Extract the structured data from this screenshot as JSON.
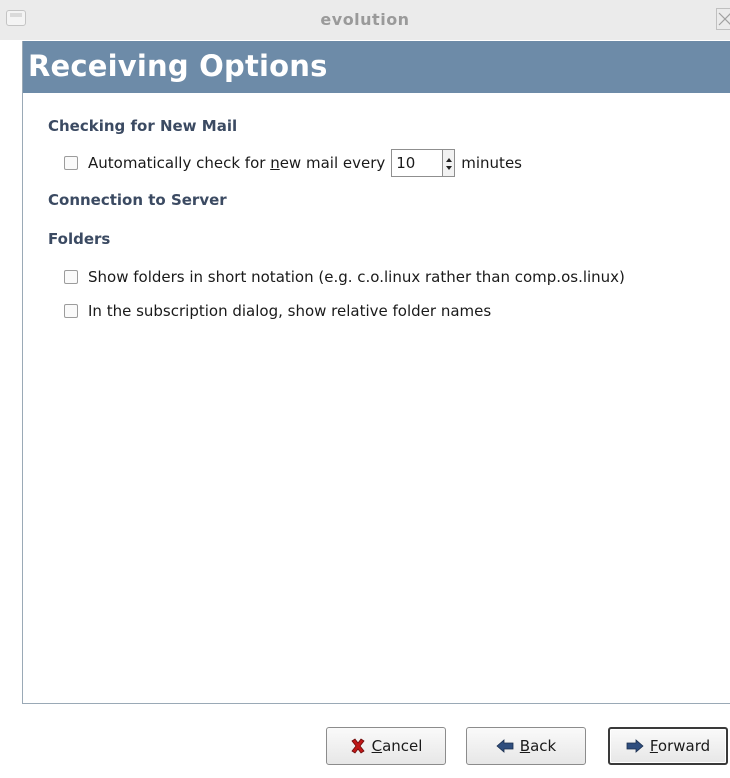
{
  "window": {
    "title": "evolution"
  },
  "header": {
    "title": "Receiving Options"
  },
  "sections": {
    "checking": {
      "title": "Checking for New Mail"
    },
    "connection": {
      "title": "Connection to Server"
    },
    "folders": {
      "title": "Folders"
    }
  },
  "auto_check": {
    "label_before": "Automatically check for ",
    "label_mnemonic": "n",
    "label_after_mnemonic": "ew mail every",
    "interval_value": "10",
    "unit": "minutes",
    "checked": false
  },
  "folder_options": [
    {
      "label": "Show folders in short notation (e.g. c.o.linux rather than comp.os.linux)",
      "checked": false
    },
    {
      "label": "In the subscription dialog, show relative folder names",
      "checked": false
    }
  ],
  "buttons": {
    "cancel": {
      "mnemonic": "C",
      "rest": "ancel",
      "icon": "cancel-x-icon"
    },
    "back": {
      "mnemonic": "B",
      "rest": "ack",
      "icon": "back-arrow-icon"
    },
    "forward": {
      "mnemonic": "F",
      "rest": "orward",
      "icon": "forward-arrow-icon"
    }
  }
}
